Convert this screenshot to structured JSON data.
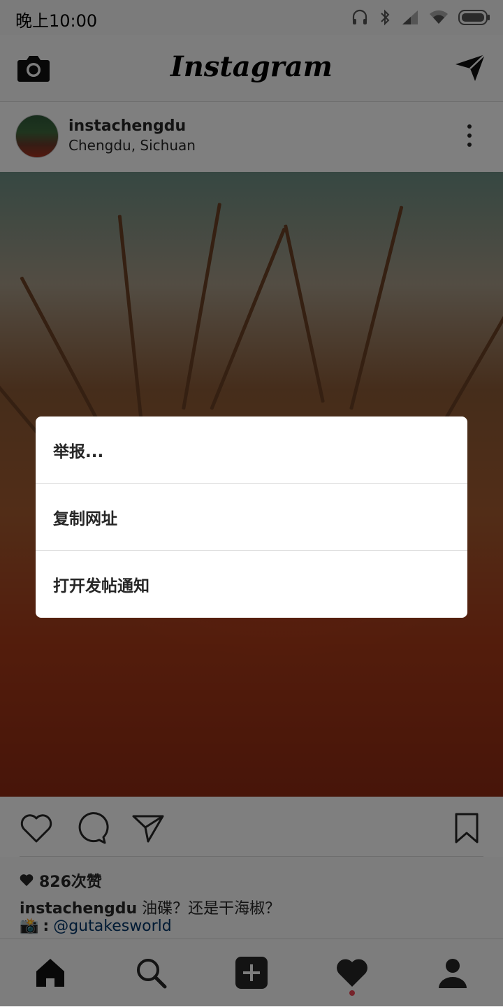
{
  "status_bar": {
    "time": "晚上10:00",
    "icons": [
      "headphones-icon",
      "bluetooth-icon",
      "signal-icon",
      "wifi-icon",
      "battery-icon"
    ]
  },
  "app_bar": {
    "brand": "Instagram",
    "left_icon": "camera-icon",
    "right_icon": "direct-message-icon"
  },
  "post": {
    "username": "instachengdu",
    "location": "Chengdu, Sichuan",
    "likes": "826次赞",
    "caption_user": "instachengdu",
    "caption_text": " 油碟？还是干海椒？",
    "credit_emoji": "📸",
    "credit_colon": ":",
    "credit_handle": "@gutakesworld"
  },
  "dialog": {
    "items": [
      {
        "label": "举报..."
      },
      {
        "label": "复制网址"
      },
      {
        "label": "打开发帖通知"
      }
    ]
  },
  "bottom_nav": {
    "items": [
      "home-icon",
      "search-icon",
      "add-post-icon",
      "activity-heart-icon",
      "profile-icon"
    ],
    "active": "home-icon",
    "notification_dot_color": "#ed4956"
  }
}
